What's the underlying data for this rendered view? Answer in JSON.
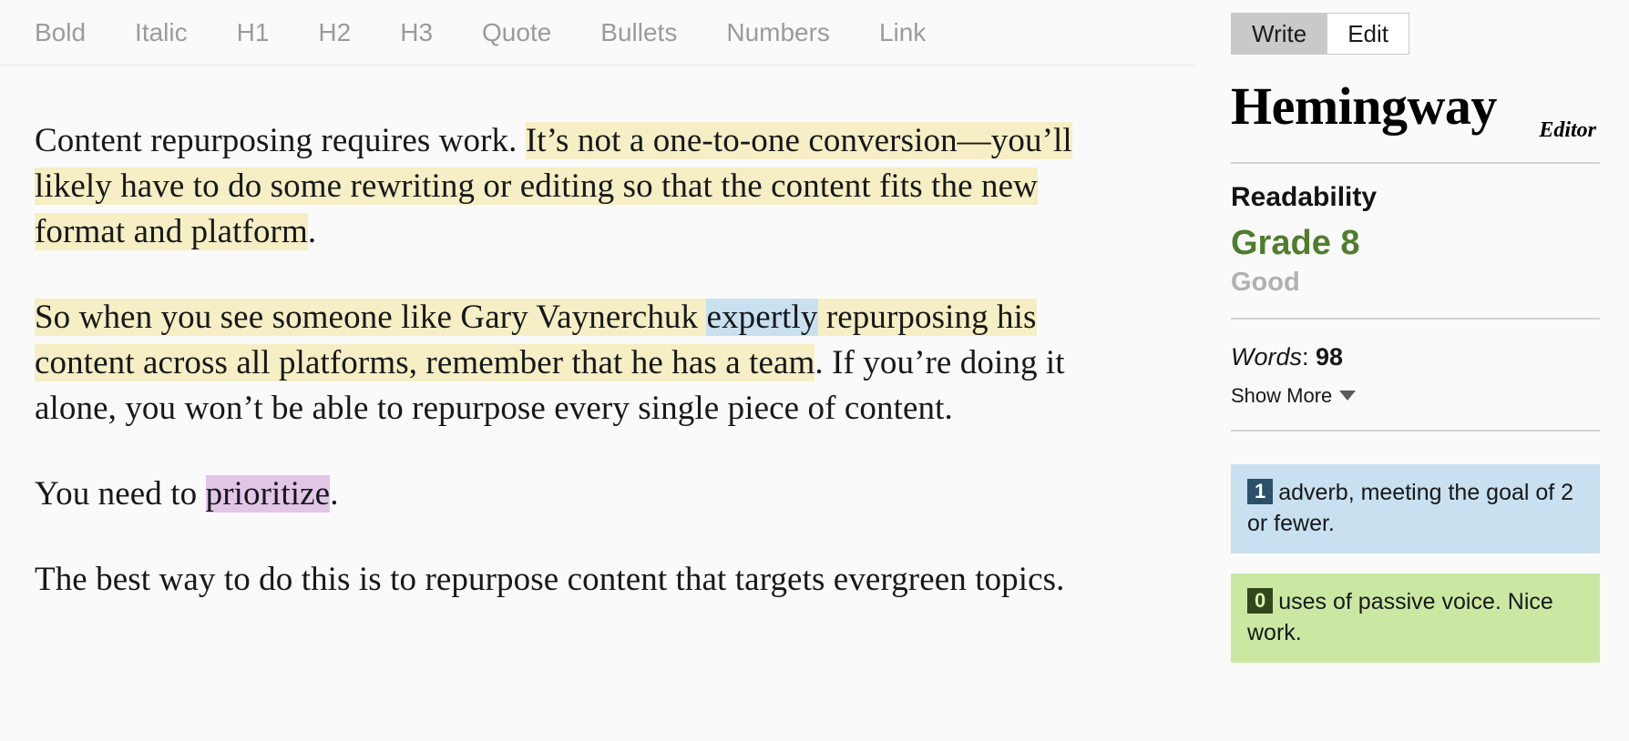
{
  "toolbar": {
    "items": [
      {
        "label": "Bold",
        "name": "bold"
      },
      {
        "label": "Italic",
        "name": "italic"
      },
      {
        "label": "H1",
        "name": "h1"
      },
      {
        "label": "H2",
        "name": "h2"
      },
      {
        "label": "H3",
        "name": "h3"
      },
      {
        "label": "Quote",
        "name": "quote"
      },
      {
        "label": "Bullets",
        "name": "bullets"
      },
      {
        "label": "Numbers",
        "name": "numbers"
      },
      {
        "label": "Link",
        "name": "link"
      }
    ]
  },
  "document": {
    "paragraphs": [
      {
        "runs": [
          {
            "text": "Content repurposing requires work. ",
            "highlight": "none"
          },
          {
            "text": "It’s not a one-to-one conversion—you’ll likely have to do some rewriting or editing so that the content fits the new format and platform",
            "highlight": "yellow"
          },
          {
            "text": ".",
            "highlight": "none"
          }
        ]
      },
      {
        "runs": [
          {
            "text": "So when you see someone like Gary Vaynerchuk ",
            "highlight": "yellow"
          },
          {
            "text": "expertly",
            "highlight": "blue"
          },
          {
            "text": " repurposing his content across all platforms, remember that he has a team",
            "highlight": "yellow"
          },
          {
            "text": ". If you’re doing it alone, you won’t be able to repurpose every single piece of content.",
            "highlight": "none"
          }
        ]
      },
      {
        "runs": [
          {
            "text": "You need to ",
            "highlight": "none"
          },
          {
            "text": "prioritize",
            "highlight": "purple"
          },
          {
            "text": ".",
            "highlight": "none"
          }
        ]
      },
      {
        "runs": [
          {
            "text": "The best way to do this is to repurpose content that targets evergreen topics.",
            "highlight": "none"
          }
        ]
      }
    ]
  },
  "sidebar": {
    "mode_toggle": {
      "write_label": "Write",
      "edit_label": "Edit",
      "selected": "Edit"
    },
    "brand": {
      "name": "Hemingway",
      "subtitle": "Editor"
    },
    "readability": {
      "heading": "Readability",
      "grade": "Grade 8",
      "grade_label": "Good",
      "grade_color": "#4f7d2d"
    },
    "stats": {
      "words_key": "Words",
      "words_separator": ": ",
      "words_value": "98",
      "show_more_label": "Show More"
    },
    "cards": [
      {
        "name": "adverb-card",
        "count": "1",
        "text": "adverb, meeting the goal of 2 or fewer.",
        "bg": "#c8e0f0",
        "badge_bg": "#2d506a"
      },
      {
        "name": "passive-voice-card",
        "count": "0",
        "text": "uses of passive voice. Nice work.",
        "bg": "#cbe8a3",
        "badge_bg": "#33471d"
      }
    ]
  }
}
